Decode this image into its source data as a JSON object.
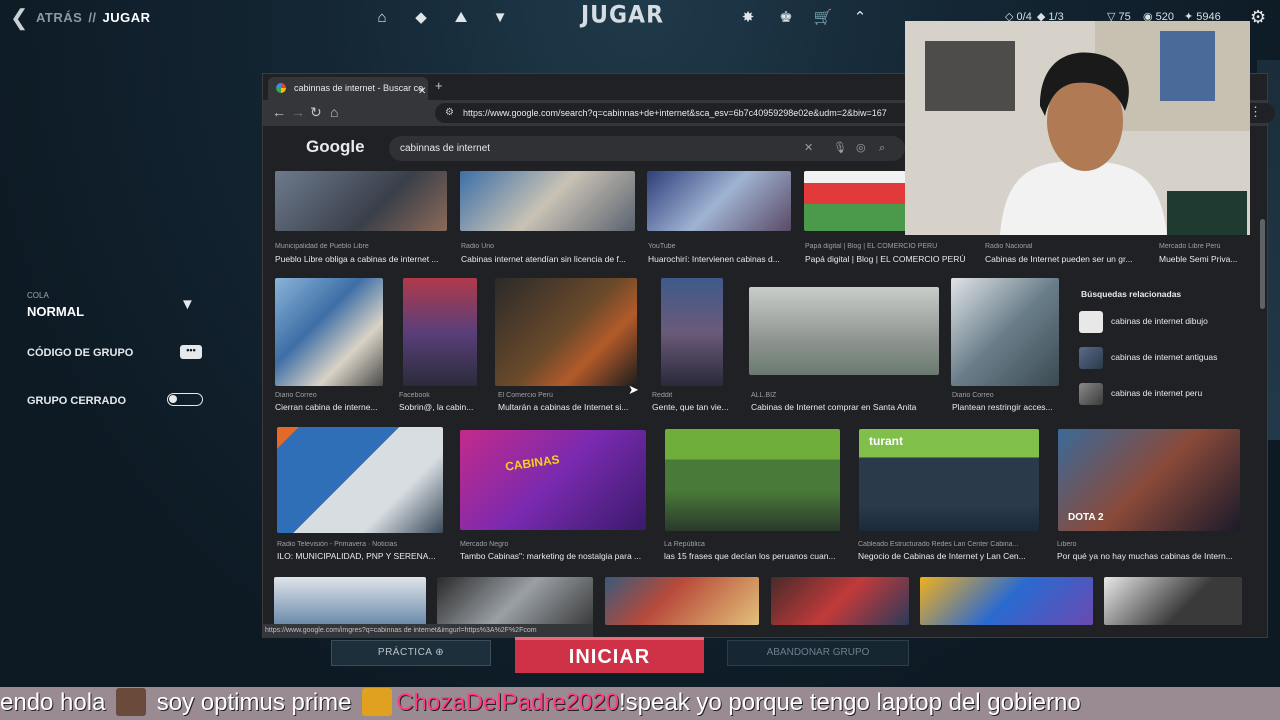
{
  "game": {
    "breadcrumb": {
      "back": "ATRÁS",
      "separator": "//",
      "current": "JUGAR"
    },
    "title": "JUGAR",
    "stats": {
      "icon1_value": "0/4",
      "icon2_value": "1/3",
      "vp": "75",
      "radianite": "520",
      "kingdom": "5946"
    },
    "left_panel": {
      "cola_label": "COLA",
      "cola_value": "NORMAL",
      "group_code_label": "CÓDIGO DE GRUPO",
      "group_closed_label": "GRUPO CERRADO"
    },
    "buttons": {
      "practice": "PRÁCTICA",
      "start": "INICIAR",
      "leave": "ABANDONAR GRUPO"
    }
  },
  "browser": {
    "tab_title": "cabinnas de internet - Buscar co",
    "url": "https://www.google.com/search?q=cabinnas+de+internet&sca_esv=6b7c40959298e02e&udm=2&biw=167",
    "google_logo": "Google",
    "search_query": "cabinnas de internet",
    "status_url": "https://www.google.com/imgres?q=cabinnas de internet&imgurl=https%3A%2F%2Fcom",
    "related": {
      "title": "Búsquedas relacionadas",
      "items": [
        "cabinas de internet dibujo",
        "cabinas de internet antiguas",
        "cabinas de internet peru"
      ]
    },
    "results": [
      {
        "source": "Municipalidad de Pueblo Libre",
        "caption": "Pueblo Libre obliga a cabinas de internet ..."
      },
      {
        "source": "Radio Uno",
        "caption": "Cabinas internet atendían sin licencia de f..."
      },
      {
        "source": "YouTube",
        "caption": "Huarochirí: Intervienen cabinas d..."
      },
      {
        "source": "Papá digital | Blog | EL COMERCIO PERÚ",
        "caption": "Papá digital | Blog | EL COMERCIO PERÚ"
      },
      {
        "source": "Radio Nacional",
        "caption": "Cabinas de Internet pueden ser un gr..."
      },
      {
        "source": "Mercado Libre Perú",
        "caption": "Mueble Semi Priva..."
      },
      {
        "source": "Diario Correo",
        "caption": "Cierran cabina de interne..."
      },
      {
        "source": "Facebook",
        "caption": "Sobrin@, la cabin..."
      },
      {
        "source": "El Comercio Perú",
        "caption": "Multarán a cabinas de Internet si..."
      },
      {
        "source": "Reddit",
        "caption": "Gente, que tan vie..."
      },
      {
        "source": "ALL.BIZ",
        "caption": "Cabinas de Internet comprar en Santa Anita"
      },
      {
        "source": "Diario Correo",
        "caption": "Plantean restringir acces..."
      },
      {
        "source": "Radio Televisión - Primavera · Noticias",
        "caption": "ILO: MUNICIPALIDAD, PNP Y SERENA..."
      },
      {
        "source": "Mercado Negro",
        "caption": "Tambo Cabinas\": marketing de nostalgia para ..."
      },
      {
        "source": "La República",
        "caption": "las 15 frases que decían los peruanos cuan..."
      },
      {
        "source": "Cableado Estructurado Redes Lan Center Cabina...",
        "caption": "Negocio de Cabinas de Internet y Lan Cen..."
      },
      {
        "source": "Libero",
        "caption": "Por qué ya no hay muchas cabinas de Intern..."
      }
    ],
    "image_texts": {
      "tambo": "CABINAS",
      "turant": "turant",
      "dota": "DOTA 2"
    }
  },
  "stream": {
    "ticker_before": "endo hola",
    "ticker_mid": "soy optimus prime",
    "ticker_name": "ChozaDelPadre2020",
    "ticker_after": "!speak yo porque tengo laptop del gobierno"
  },
  "colors": {
    "accent_red": "#cf3147",
    "bg": "#0f1923",
    "ticker_name": "#ff3b86"
  }
}
